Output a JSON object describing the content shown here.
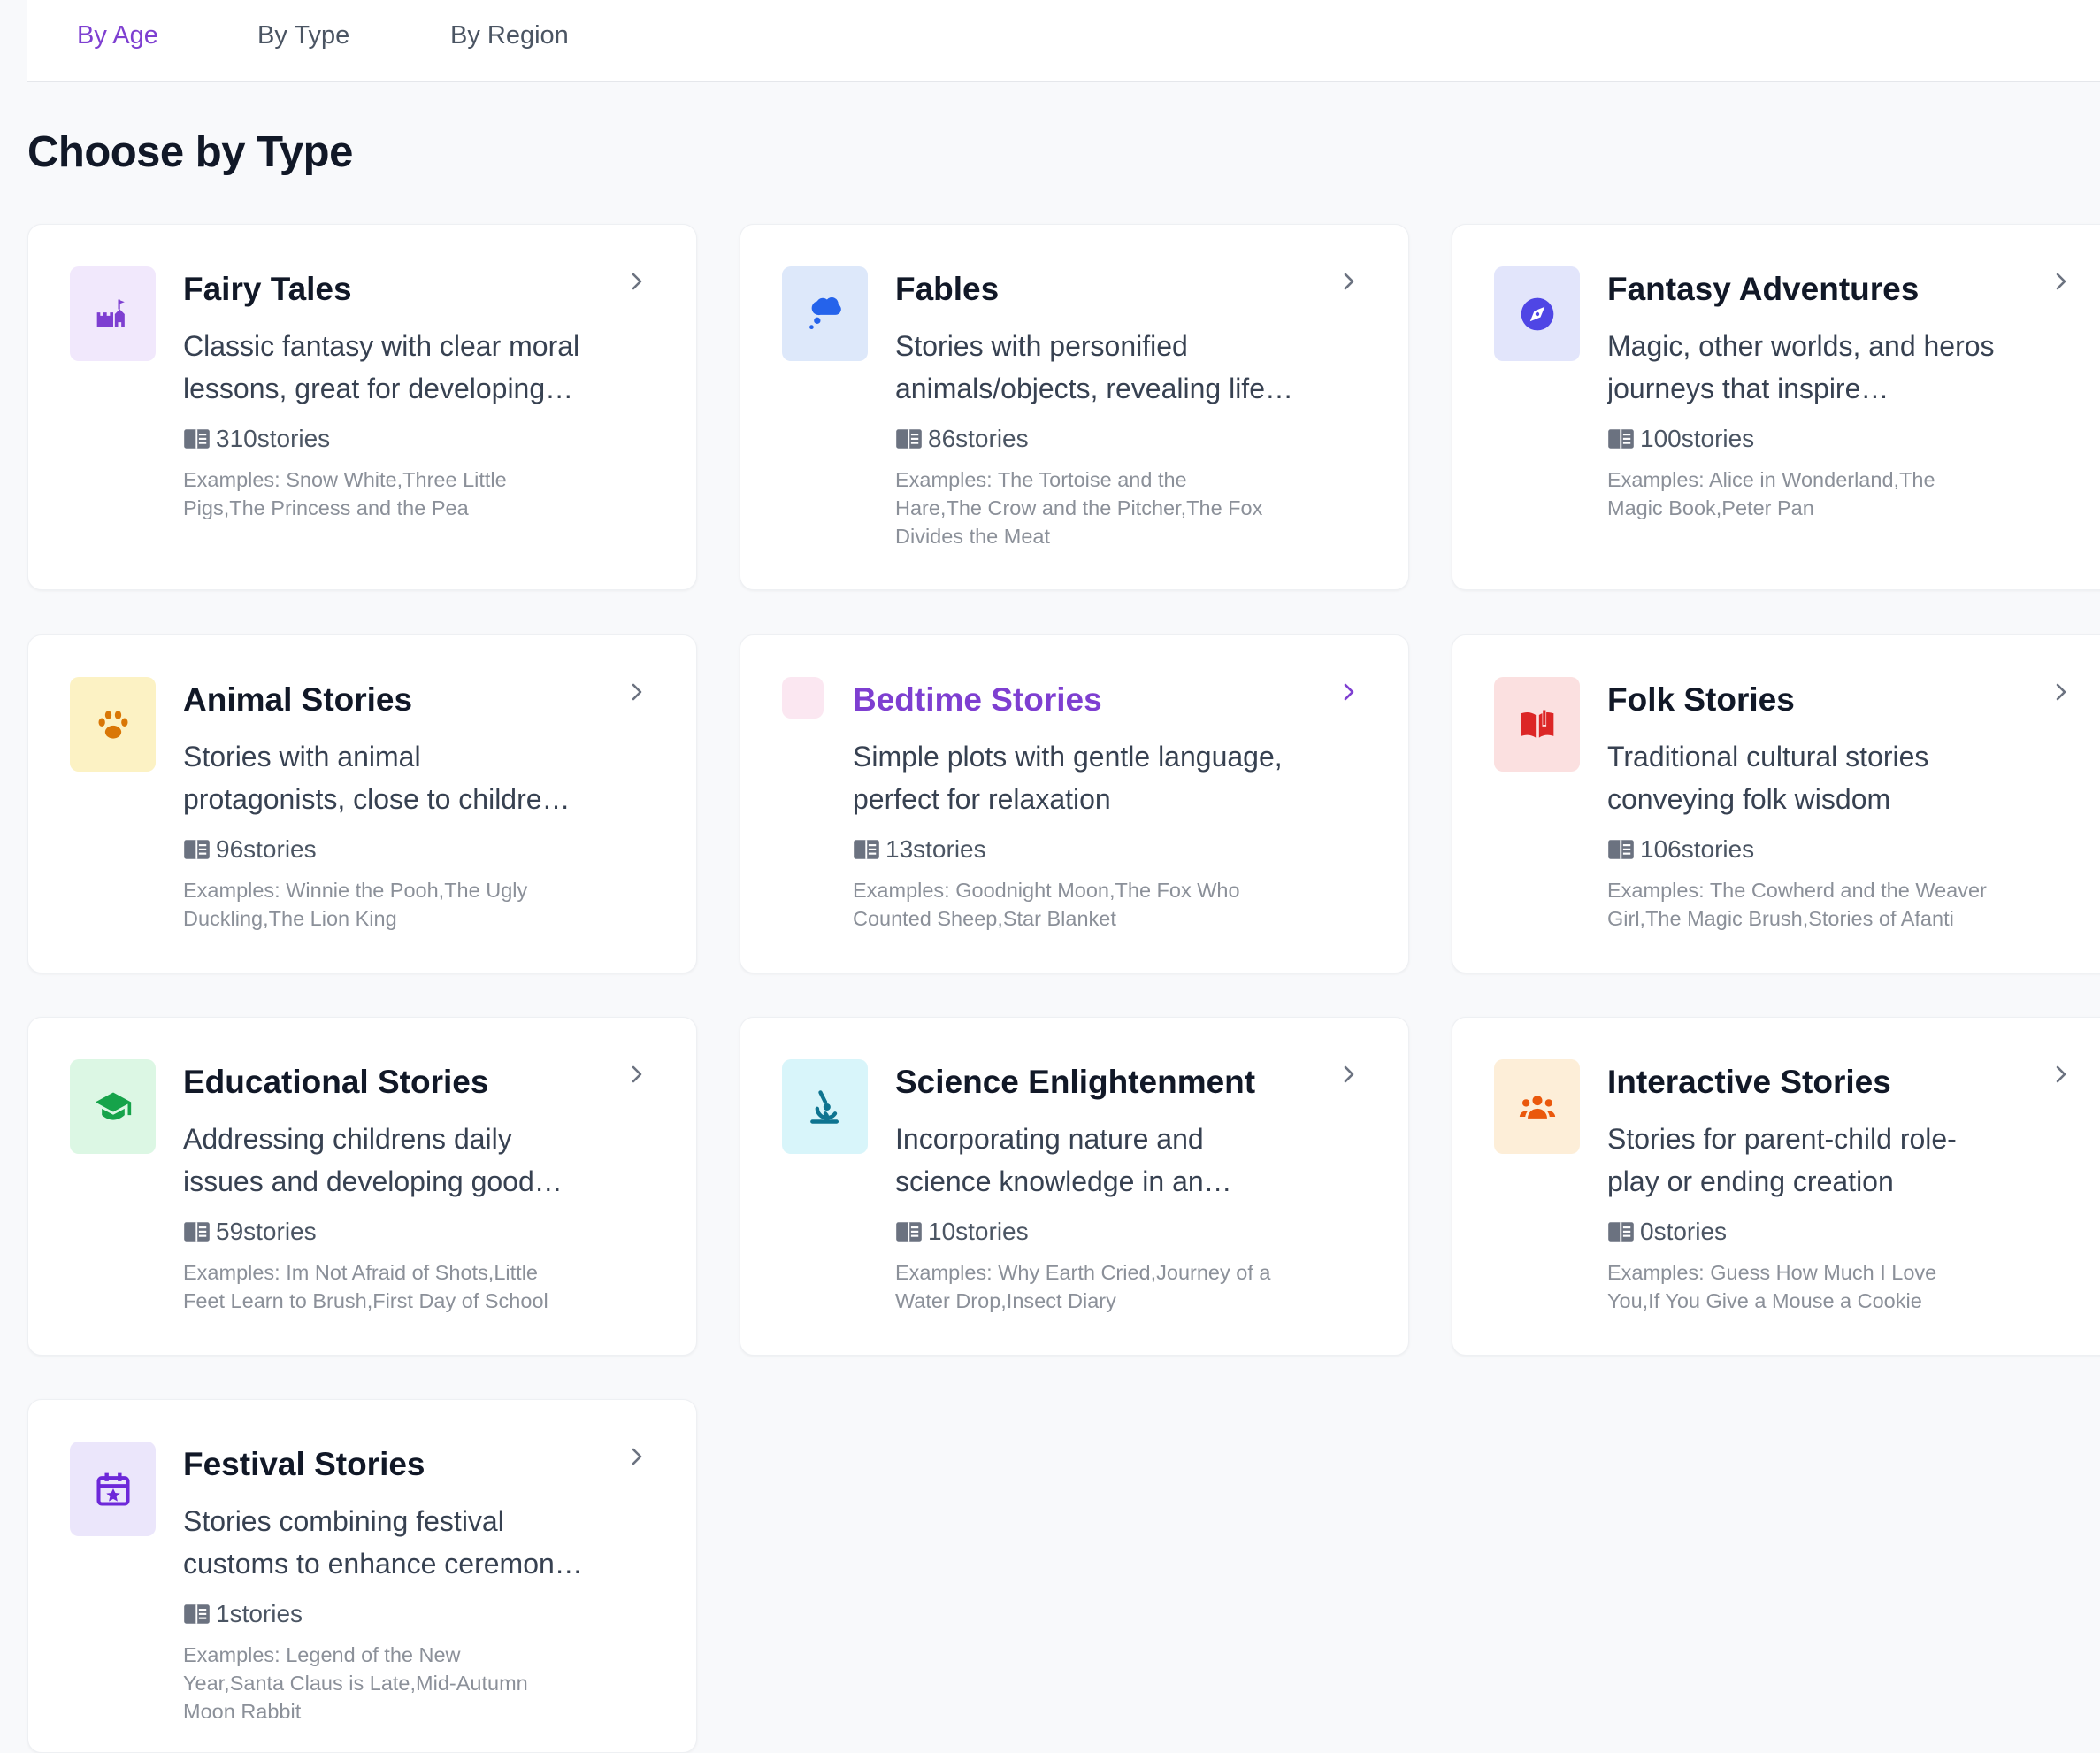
{
  "tabs": [
    {
      "label": "By Age",
      "active": true
    },
    {
      "label": "By Type",
      "active": false
    },
    {
      "label": "By Region",
      "active": false
    }
  ],
  "page_title": "Choose by Type",
  "colors": {
    "accent": "#7e3fd1"
  },
  "cards": [
    {
      "title": "Fairy Tales",
      "desc": [
        "Classic fantasy with clear moral",
        "lessons, great for developing…"
      ],
      "count": "310stories",
      "examples": [
        "Examples: Snow White,Three Little",
        "Pigs,The Princess and the Pea"
      ],
      "icon": "castle-icon",
      "icon_bg": "#f1e8fc",
      "icon_color": "#7e3fd1"
    },
    {
      "title": "Fables",
      "desc": [
        "Stories with personified",
        "animals/objects, revealing life…"
      ],
      "count": "86stories",
      "examples": [
        "Examples: The Tortoise and the",
        "Hare,The Crow and the Pitcher,The Fox",
        "Divides the Meat"
      ],
      "icon": "thought-bubble-icon",
      "icon_bg": "#dde8fa",
      "icon_color": "#2563eb"
    },
    {
      "title": "Fantasy Adventures",
      "desc": [
        "Magic, other worlds, and heros",
        "journeys that inspire…"
      ],
      "count": "100stories",
      "examples": [
        "Examples: Alice in Wonderland,The",
        "Magic Book,Peter Pan"
      ],
      "icon": "compass-icon",
      "icon_bg": "#e2e5fb",
      "icon_color": "#4f46e5"
    },
    {
      "title": "Animal Stories",
      "desc": [
        "Stories with animal",
        "protagonists, close to childre…"
      ],
      "count": "96stories",
      "examples": [
        "Examples: Winnie the Pooh,The Ugly",
        "Duckling,The Lion King"
      ],
      "icon": "paw-icon",
      "icon_bg": "#fcf2c4",
      "icon_color": "#d97706"
    },
    {
      "title": "Bedtime Stories",
      "desc": [
        "Simple plots with gentle language,",
        "perfect for relaxation"
      ],
      "count": "13stories",
      "examples": [
        "Examples: Goodnight Moon,The Fox Who",
        "Counted Sheep,Star Blanket"
      ],
      "icon": "moon-icon",
      "icon_bg": "#fbe7f1",
      "icon_color": "#db2777",
      "selected": true
    },
    {
      "title": "Folk Stories",
      "desc": [
        "Traditional cultural stories",
        "conveying folk wisdom"
      ],
      "count": "106stories",
      "examples": [
        "Examples: The Cowherd and the Weaver",
        "Girl,The Magic Brush,Stories of Afanti"
      ],
      "icon": "open-book-icon",
      "icon_bg": "#fbe0e0",
      "icon_color": "#dc2626"
    },
    {
      "title": "Educational Stories",
      "desc": [
        "Addressing childrens daily",
        "issues and developing good…"
      ],
      "count": "59stories",
      "examples": [
        "Examples: Im Not Afraid of Shots,Little",
        "Feet Learn to Brush,First Day of School"
      ],
      "icon": "graduation-cap-icon",
      "icon_bg": "#dcf7e4",
      "icon_color": "#16a34a"
    },
    {
      "title": "Science Enlightenment",
      "desc": [
        "Incorporating nature and",
        "science knowledge in an…"
      ],
      "count": "10stories",
      "examples": [
        "Examples: Why Earth Cried,Journey of a",
        "Water Drop,Insect Diary"
      ],
      "icon": "microscope-icon",
      "icon_bg": "#d8f5fa",
      "icon_color": "#0e7490"
    },
    {
      "title": "Interactive Stories",
      "desc": [
        "Stories for parent-child role-",
        "play or ending creation"
      ],
      "count": "0stories",
      "examples": [
        "Examples: Guess How Much I Love",
        "You,If You Give a Mouse a Cookie"
      ],
      "icon": "people-group-icon",
      "icon_bg": "#fdeed8",
      "icon_color": "#ea580c"
    },
    {
      "title": "Festival Stories",
      "desc": [
        "Stories combining festival",
        "customs to enhance ceremon…"
      ],
      "count": "1stories",
      "examples": [
        "Examples: Legend of the New",
        "Year,Santa Claus is Late,Mid-Autumn",
        "Moon Rabbit"
      ],
      "icon": "calendar-star-icon",
      "icon_bg": "#ebe6fb",
      "icon_color": "#6d28d9"
    }
  ]
}
